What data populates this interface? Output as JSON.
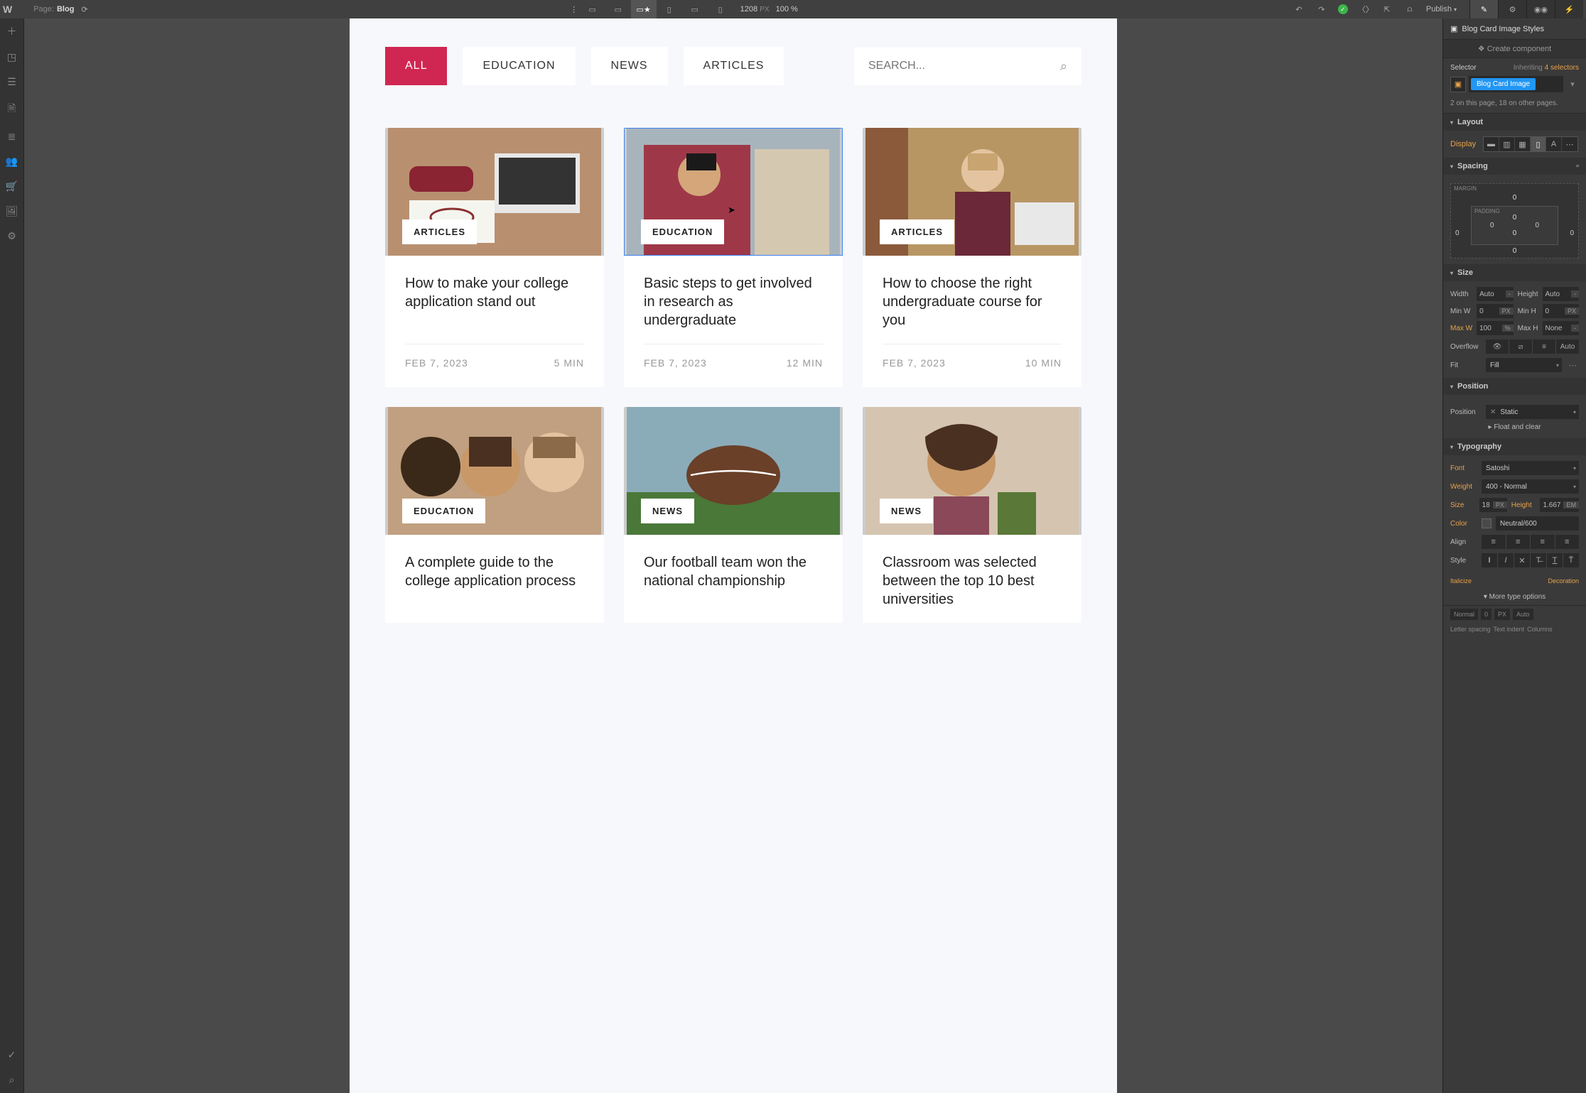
{
  "topbar": {
    "page_label": "Page:",
    "page_name": "Blog",
    "viewport_size": "1208",
    "viewport_unit": "PX",
    "zoom": "100 %",
    "publish": "Publish"
  },
  "filters": {
    "tabs": [
      "ALL",
      "EDUCATION",
      "NEWS",
      "ARTICLES"
    ],
    "active_index": 0,
    "search_placeholder": "SEARCH..."
  },
  "cards": [
    {
      "category": "ARTICLES",
      "title": "How to make your college application stand out",
      "date": "FEB 7, 2023",
      "read": "5 MIN",
      "selected": false
    },
    {
      "category": "EDUCATION",
      "title": "Basic steps to get involved in research as undergraduate",
      "date": "FEB 7, 2023",
      "read": "12 MIN",
      "selected": true,
      "sel_label": "Blog Card Image"
    },
    {
      "category": "ARTICLES",
      "title": "How to choose the right undergraduate course for you",
      "date": "FEB 7, 2023",
      "read": "10 MIN",
      "selected": false
    },
    {
      "category": "EDUCATION",
      "title": "A complete guide to the college application process",
      "date": "",
      "read": "",
      "selected": false
    },
    {
      "category": "NEWS",
      "title": "Our football team won the national championship",
      "date": "",
      "read": "",
      "selected": false
    },
    {
      "category": "NEWS",
      "title": "Classroom was selected between the top 10 best universities",
      "date": "",
      "read": "",
      "selected": false
    }
  ],
  "rpanel": {
    "header": "Blog Card Image Styles",
    "create_component": "Create component",
    "selector_label": "Selector",
    "inheriting_label": "Inheriting",
    "inheriting_count": "4 selectors",
    "class_name": "Blog Card Image",
    "instances_note": "2 on this page, 18 on other pages.",
    "sections": {
      "layout": "Layout",
      "spacing": "Spacing",
      "size": "Size",
      "position": "Position",
      "typography": "Typography"
    },
    "display_label": "Display",
    "spacing": {
      "margin_label": "MARGIN",
      "padding_label": "PADDING",
      "m_top": "0",
      "m_right": "0",
      "m_bottom": "0",
      "m_left": "0",
      "p_top": "0",
      "p_right": "0",
      "p_bottom": "0",
      "p_left": "0"
    },
    "size": {
      "width_label": "Width",
      "width_val": "Auto",
      "width_unit": "-",
      "height_label": "Height",
      "height_val": "Auto",
      "height_unit": "-",
      "minw_label": "Min W",
      "minw_val": "0",
      "minw_unit": "PX",
      "minh_label": "Min H",
      "minh_val": "0",
      "minh_unit": "PX",
      "maxw_label": "Max W",
      "maxw_val": "100",
      "maxw_unit": "%",
      "maxh_label": "Max H",
      "maxh_val": "None",
      "maxh_unit": "-",
      "overflow_label": "Overflow",
      "overflow_auto": "Auto",
      "fit_label": "Fit",
      "fit_val": "Fill"
    },
    "position": {
      "pos_label": "Position",
      "pos_val": "Static",
      "float_label": "Float and clear"
    },
    "typography": {
      "font_label": "Font",
      "font_val": "Satoshi",
      "weight_label": "Weight",
      "weight_val": "400 - Normal",
      "size_label": "Size",
      "size_val": "18",
      "size_unit": "PX",
      "lh_label": "Height",
      "lh_val": "1.667",
      "lh_unit": "EM",
      "color_label": "Color",
      "color_val": "Neutral/600",
      "align_label": "Align",
      "style_label": "Style",
      "italicize": "Italicize",
      "decoration": "Decoration",
      "more": "More type options",
      "normal": "Normal",
      "zero": "0",
      "px": "PX",
      "auto": "Auto",
      "ls": "Letter spacing",
      "ti": "Text indent",
      "col": "Columns"
    }
  }
}
